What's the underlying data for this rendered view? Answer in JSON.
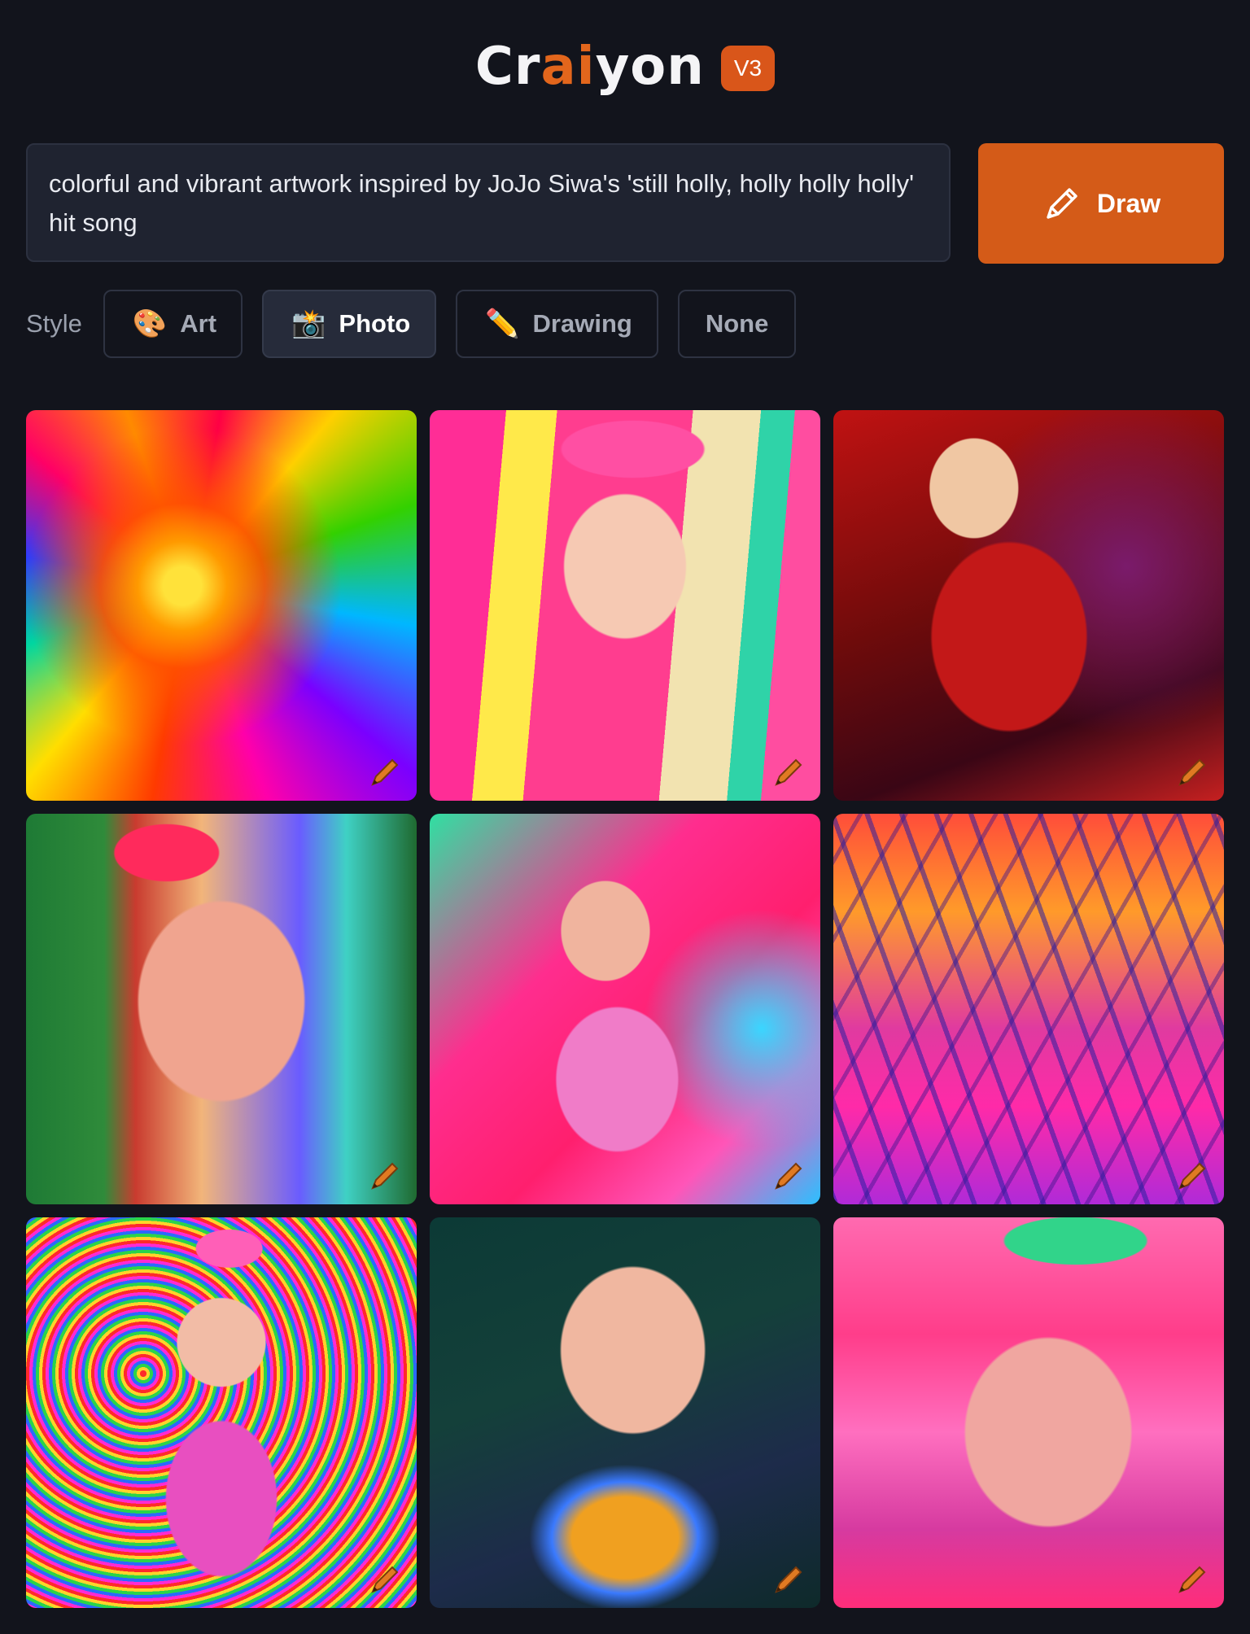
{
  "header": {
    "logo_part1": "Cr",
    "logo_accent1": "ai",
    "logo_part2": "y",
    "logo_part3": "on",
    "version": "V3"
  },
  "prompt": {
    "text": "colorful and vibrant artwork inspired by JoJo Siwa's 'still holly, holly holly holly' hit song"
  },
  "draw_button": {
    "label": "Draw",
    "icon": "pencil-icon",
    "color": "#d45b18"
  },
  "style": {
    "label": "Style",
    "options": [
      {
        "label": "Art",
        "emoji": "🎨",
        "active": false
      },
      {
        "label": "Photo",
        "emoji": "📸",
        "active": true
      },
      {
        "label": "Drawing",
        "emoji": "✏️",
        "active": false
      },
      {
        "label": "None",
        "emoji": "",
        "active": false
      }
    ]
  },
  "gallery": {
    "count": 9,
    "edit_icon": "pencil-icon"
  },
  "colors": {
    "background": "#12141c",
    "accent": "#e2661c"
  }
}
